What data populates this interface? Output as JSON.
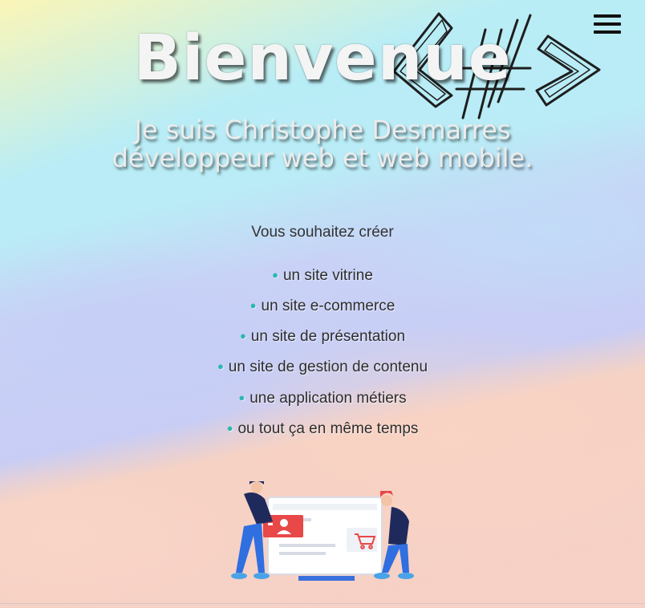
{
  "header": {
    "menu_icon": "hamburger-menu-icon",
    "logo_icon": "code-brackets-logo-icon"
  },
  "hero": {
    "title": "Bienvenue",
    "subtitle_line1": "Je suis Christophe Desmarres",
    "subtitle_line2": "développeur web et web mobile."
  },
  "offer": {
    "question": "Vous souhaitez créer",
    "items": [
      "un site vitrine",
      "un site e-commerce",
      "un site de présentation",
      "un site de gestion de contenu",
      "une application métiers",
      "ou tout ça en même temps"
    ]
  },
  "illustration": {
    "icon": "web-team-illustration",
    "accent_color": "#e84848",
    "figure_color": "#2f6fe0"
  }
}
